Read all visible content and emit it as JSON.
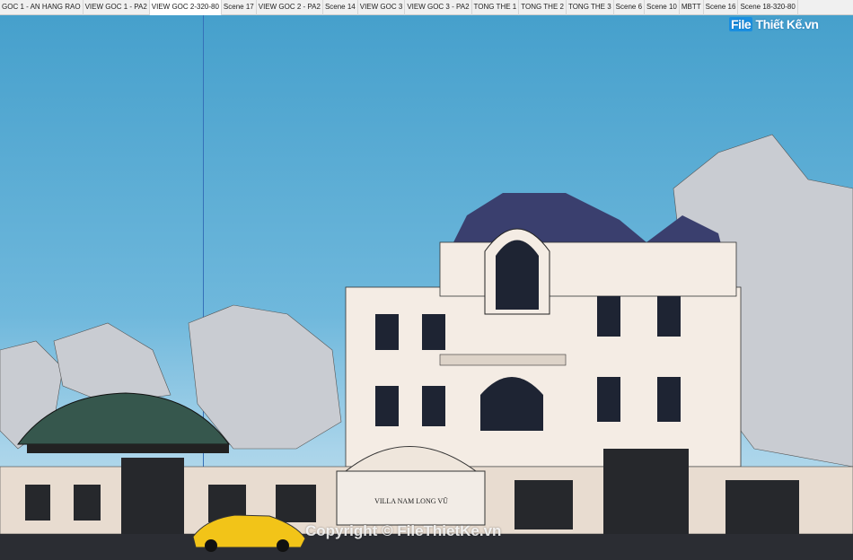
{
  "scene_tabs": [
    "GOC 1 - AN HANG RAO",
    "VIEW GOC 1 - PA2",
    "VIEW GOC 2-320-80",
    "Scene 17",
    "VIEW GOC 2 - PA2",
    "Scene 14",
    "VIEW GOC 3",
    "VIEW GOC 3 - PA2",
    "TONG THE 1",
    "TONG THE 2",
    "TONG THE 3",
    "Scene 6",
    "Scene 10",
    "MBTT",
    "Scene 16",
    "Scene 18-320-80"
  ],
  "active_tab": "VIEW GOC 2-320-80",
  "watermark": {
    "logo_file": "File",
    "logo_rest": "Thiết Kế.vn",
    "copyright": "Copyright © FileThietKe.vn"
  },
  "gate_sign": "VILLA NAM LONG VŨ",
  "colors": {
    "sky_top": "#46a0cc",
    "sky_bottom": "#c8e1ee",
    "roof": "#3a3f6e",
    "wall": "#f4ece4",
    "car": "#f2c418",
    "axis": "#3570b8"
  }
}
